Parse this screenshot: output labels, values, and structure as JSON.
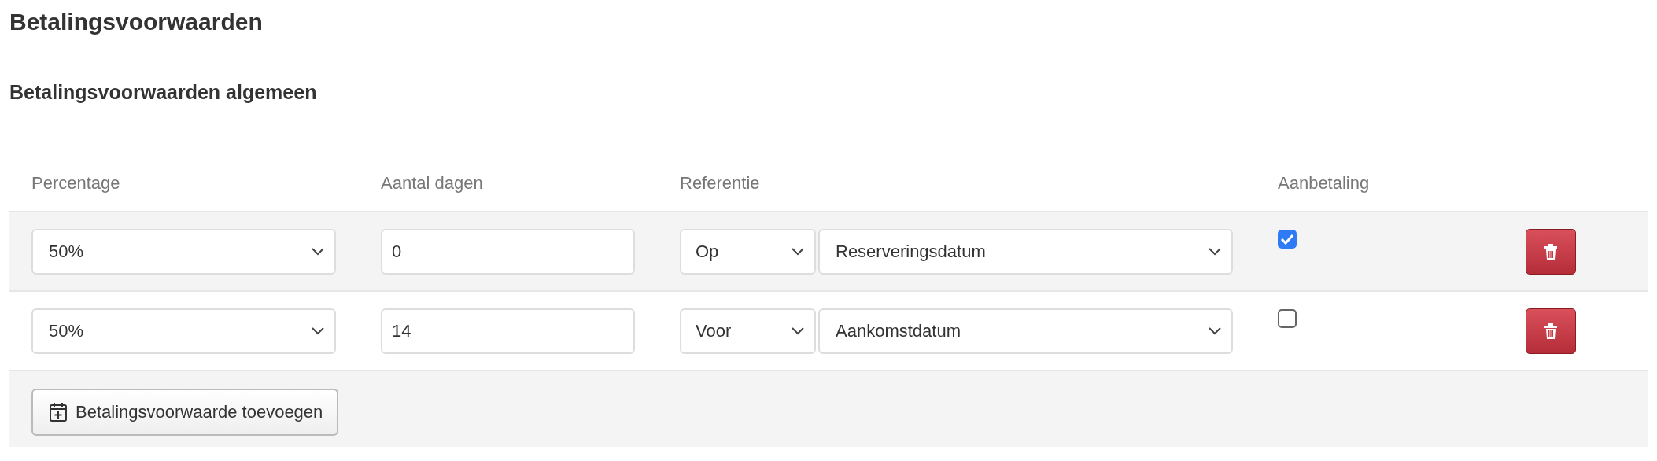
{
  "title": "Betalingsvoorwaarden",
  "section_title": "Betalingsvoorwaarden algemeen",
  "table": {
    "columns": [
      "Percentage",
      "Aantal dagen",
      "Referentie",
      "Aanbetaling"
    ],
    "rows": [
      {
        "percentage": "50%",
        "days": "0",
        "reference_direction": "Op",
        "reference_date": "Reserveringsdatum",
        "down_payment": true
      },
      {
        "percentage": "50%",
        "days": "14",
        "reference_direction": "Voor",
        "reference_date": "Aankomstdatum",
        "down_payment": false
      }
    ]
  },
  "add_button": "Betalingsvoorwaarde toevoegen"
}
